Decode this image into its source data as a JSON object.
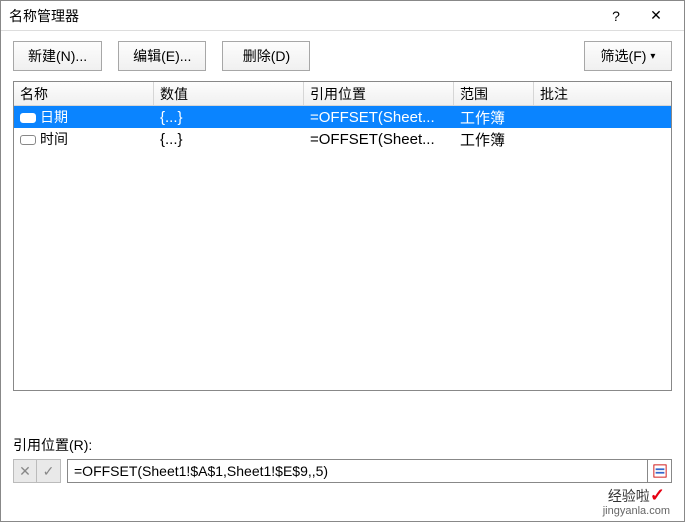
{
  "titlebar": {
    "title": "名称管理器",
    "help": "?",
    "close": "✕"
  },
  "toolbar": {
    "new_label": "新建(N)...",
    "edit_label": "编辑(E)...",
    "delete_label": "删除(D)",
    "filter_label": "筛选(F)"
  },
  "columns": {
    "name": "名称",
    "value": "数值",
    "refers": "引用位置",
    "scope": "范围",
    "comment": "批注"
  },
  "rows": [
    {
      "name": "日期",
      "value": "{...}",
      "refers": "=OFFSET(Sheet...",
      "scope": "工作簿",
      "comment": ""
    },
    {
      "name": "时间",
      "value": "{...}",
      "refers": "=OFFSET(Sheet...",
      "scope": "工作簿",
      "comment": ""
    }
  ],
  "refersto": {
    "label": "引用位置(R):",
    "value": "=OFFSET(Sheet1!$A$1,Sheet1!$E$9,,5)"
  },
  "watermark": {
    "main": "经验啦",
    "sub": "jingyanla.com"
  }
}
